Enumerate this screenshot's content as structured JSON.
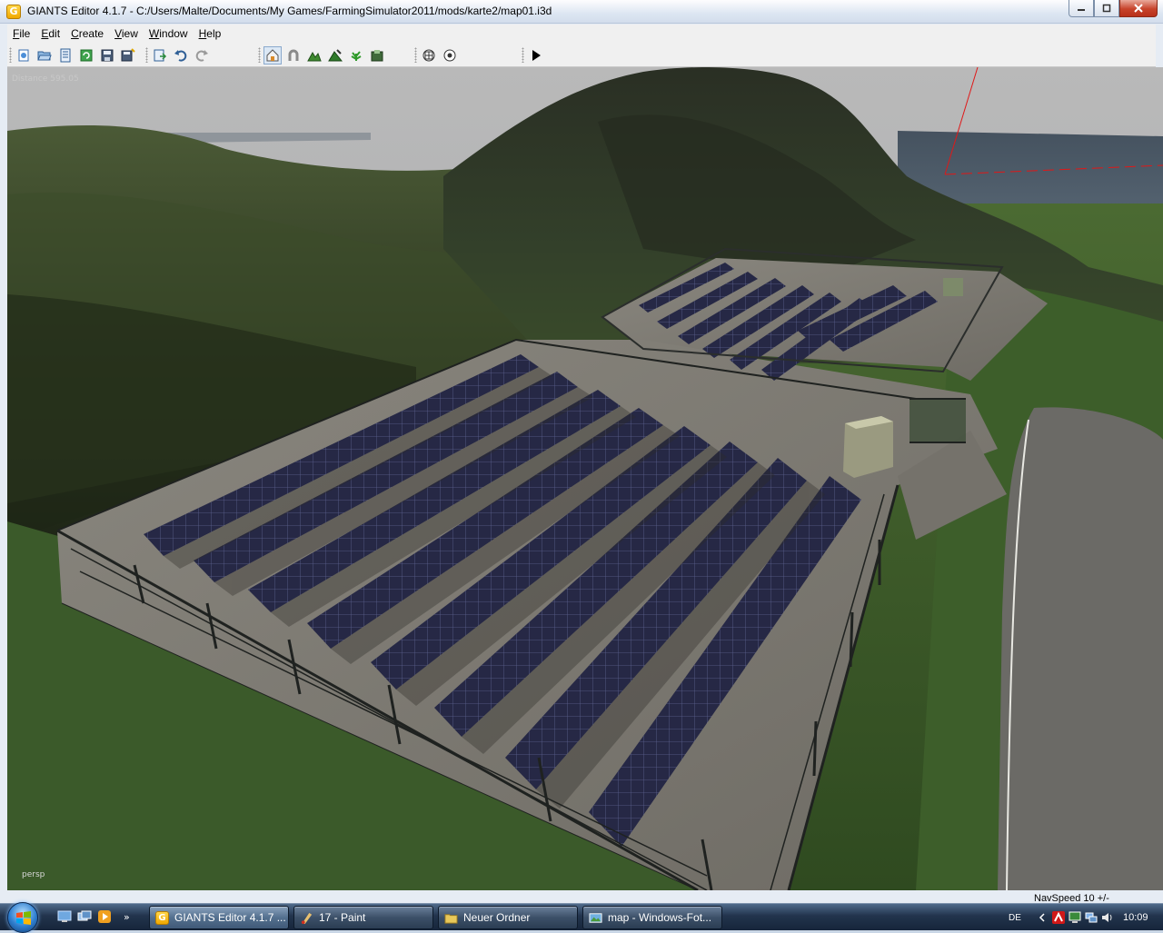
{
  "window": {
    "title": "GIANTS Editor 4.1.7 - C:/Users/Malte/Documents/My Games/FarmingSimulator2011/mods/karte2/map01.i3d",
    "app_icon": "giants-editor-icon",
    "controls": {
      "minimize": "minimize-icon",
      "maximize": "maximize-icon",
      "close": "close-icon"
    }
  },
  "menu": {
    "items": [
      {
        "label": "File"
      },
      {
        "label": "Edit"
      },
      {
        "label": "Create"
      },
      {
        "label": "View"
      },
      {
        "label": "Window"
      },
      {
        "label": "Help"
      }
    ]
  },
  "toolbar": {
    "file_tools": [
      "new-scene-icon",
      "open-icon",
      "properties-icon",
      "reload-icon",
      "save-icon",
      "save-all-icon"
    ],
    "edit_tools": [
      "import-icon",
      "undo-icon",
      "redo-icon"
    ],
    "modes": [
      "select-mode-icon",
      "magnet-icon",
      "terrain-sculpt-icon",
      "terrain-paint-icon",
      "foliage-paint-icon",
      "info-layer-icon"
    ],
    "snap_tools": [
      "snap-grid-icon",
      "snap-object-icon"
    ],
    "play": "play-icon",
    "active_mode": "select-mode-icon"
  },
  "viewport": {
    "distance_label": "Distance 595.05",
    "camera_label": "persp",
    "navspeed_label": "NavSpeed 10 +/-"
  },
  "taskbar": {
    "start": "windows-start-orb",
    "quicklaunch": [
      "show-desktop-icon",
      "switch-windows-icon",
      "media-player-icon"
    ],
    "quicklaunch_more": "»",
    "tasks": [
      {
        "label": "GIANTS Editor 4.1.7 ...",
        "icon": "giants-editor-icon",
        "active": true
      },
      {
        "label": "17 - Paint",
        "icon": "paint-icon",
        "active": false
      },
      {
        "label": "Neuer Ordner",
        "icon": "folder-icon",
        "active": false
      },
      {
        "label": "map - Windows-Fot...",
        "icon": "photo-viewer-icon",
        "active": false
      }
    ],
    "language": "DE",
    "tray_icons": [
      "chevron-left-icon",
      "antivir-icon",
      "network-activity-icon",
      "network-icon",
      "volume-icon"
    ],
    "clock": "10:09"
  },
  "colors": {
    "titlebar": "#dde6f2",
    "taskbar": "#22344d",
    "grass": "#3c4f22",
    "panels": "#22223a",
    "concrete": "#7e7a72"
  }
}
